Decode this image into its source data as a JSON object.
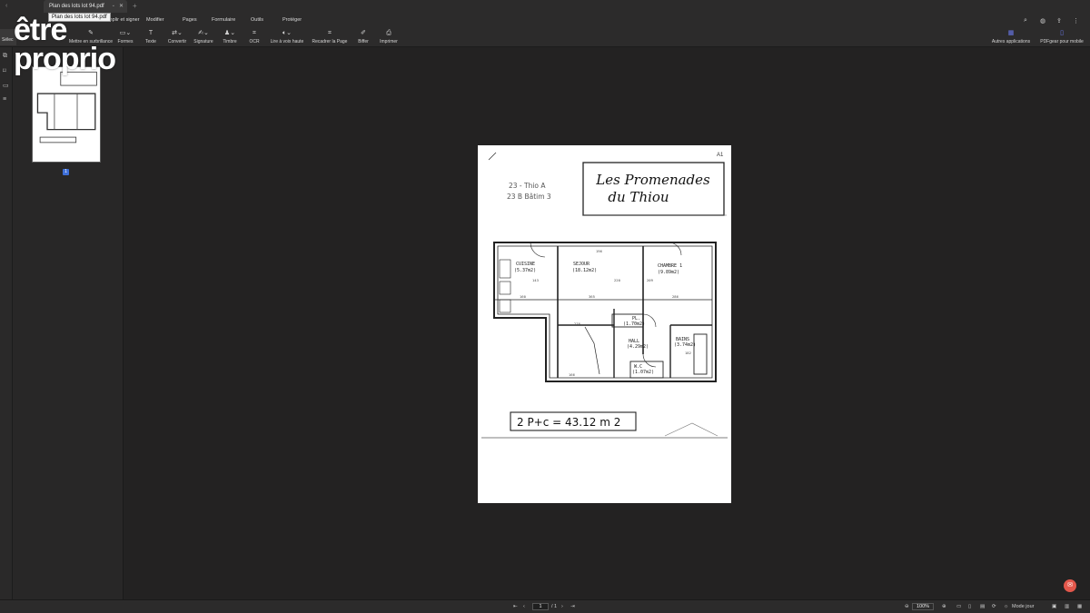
{
  "window": {
    "tab_title": "Plan des lots lot 94.pdf",
    "tooltip": "Plan des lots lot 94.pdf"
  },
  "menu": {
    "items": [
      "Remplir et signer",
      "Modifier",
      "Pages",
      "Formulaire",
      "Outils",
      "Protéger"
    ]
  },
  "toolbar": {
    "select_label": "Sélec",
    "tools": [
      {
        "label": "Mettre en surbrillance",
        "icon": "highlighter-icon"
      },
      {
        "label": "Formes",
        "icon": "shapes-icon"
      },
      {
        "label": "Texte",
        "icon": "text-icon"
      },
      {
        "label": "Convertir",
        "icon": "convert-icon"
      },
      {
        "label": "Signature",
        "icon": "signature-icon"
      },
      {
        "label": "Timbre",
        "icon": "stamp-icon"
      },
      {
        "label": "OCR",
        "icon": "ocr-icon"
      },
      {
        "label": "Lire à voix haute",
        "icon": "read-aloud-icon"
      },
      {
        "label": "Recadrer la Page",
        "icon": "crop-icon"
      },
      {
        "label": "Biffer",
        "icon": "redact-icon"
      },
      {
        "label": "Imprimer",
        "icon": "print-icon"
      }
    ],
    "right_tools": [
      {
        "label": "Autres applications",
        "icon": "apps-icon"
      },
      {
        "label": "PDFgear pour mobile",
        "icon": "mobile-icon"
      }
    ]
  },
  "thumbnail": {
    "page_number": "1"
  },
  "watermark": {
    "line1": "être",
    "line2": "proprio"
  },
  "document": {
    "corner_ref": "A1",
    "header_line1": "Les Promenades",
    "header_line2": "du Thiou",
    "hand_note_1": "23 - Thio A",
    "hand_note_2": "23 B Bâtim 3",
    "rooms": [
      {
        "name": "CUISINE",
        "area": "(5.37m2)"
      },
      {
        "name": "SEJOUR",
        "area": "(18.12m2)"
      },
      {
        "name": "CHAMBRE 1",
        "area": "(9.89m2)"
      },
      {
        "name": "HALL",
        "area": "(4.29m2)"
      },
      {
        "name": "BAINS",
        "area": "(3.74m2)"
      },
      {
        "name": "PL.",
        "area": "(1.70m2)"
      },
      {
        "name": "W.C",
        "area": "(1.07m2)"
      }
    ],
    "dimensions": [
      "196",
      "365",
      "286",
      "160",
      "166",
      "182",
      "276",
      "220",
      "209",
      "143"
    ],
    "summary": "2 P+c = 43.12 m 2"
  },
  "statusbar": {
    "page_current": "1",
    "page_total": "/ 1",
    "zoom": "100%",
    "view_mode": "Mode jour"
  }
}
